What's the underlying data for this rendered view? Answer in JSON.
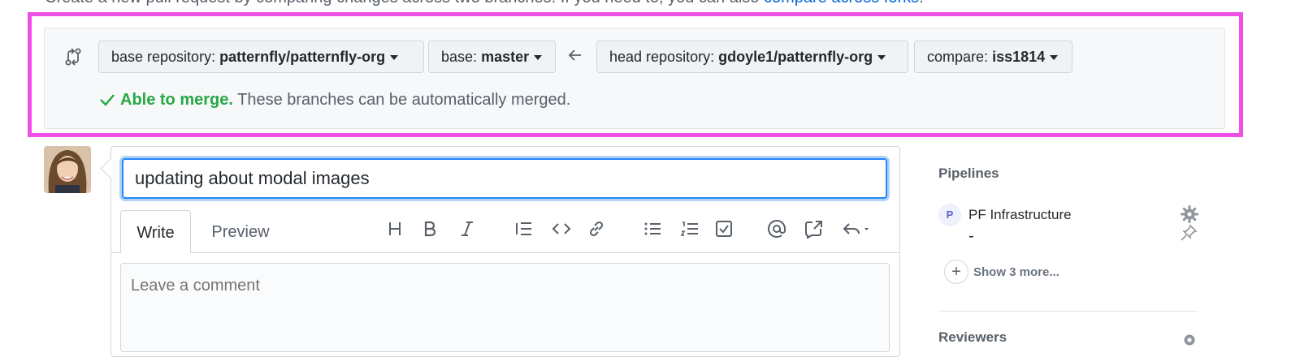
{
  "intro": {
    "text": "Create a new pull request by comparing changes across two branches. If you need to, you can also ",
    "link": "compare across forks",
    "suffix": "."
  },
  "range": {
    "base_repo_label": "base repository:",
    "base_repo_value": "patternfly/patternfly-org",
    "base_label": "base:",
    "base_value": "master",
    "head_repo_label": "head repository:",
    "head_repo_value": "gdoyle1/patternfly-org",
    "compare_label": "compare:",
    "compare_value": "iss1814",
    "merge_ok": "Able to merge.",
    "merge_text": " These branches can be automatically merged."
  },
  "form": {
    "title_value": "updating about modal images",
    "tabs": [
      "Write",
      "Preview"
    ],
    "comment_placeholder": "Leave a comment",
    "toolbar_icons": [
      "heading-icon",
      "bold-icon",
      "italic-icon",
      "quote-icon",
      "code-icon",
      "link-icon",
      "bulleted-list-icon",
      "numbered-list-icon",
      "task-list-icon",
      "mention-icon",
      "cross-reference-icon",
      "reply-icon"
    ]
  },
  "sidebar": {
    "pipelines_heading": "Pipelines",
    "pipeline_avatar": "P",
    "pipeline_name": "PF Infrastructure",
    "pipeline_value": "-",
    "show_more": "Show 3 more...",
    "next_heading": "Reviewers"
  },
  "colors": {
    "highlight": "#ee4fe6",
    "merge_ok": "#28a745",
    "link": "#0366d6",
    "focus": "#2188ff"
  }
}
